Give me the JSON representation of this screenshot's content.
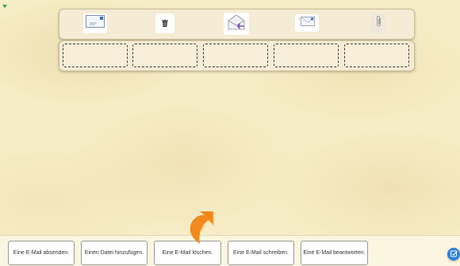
{
  "toolbar_icons": [
    {
      "name": "send-mail-icon"
    },
    {
      "name": "trash-icon"
    },
    {
      "name": "reply-mail-icon"
    },
    {
      "name": "write-mail-icon"
    },
    {
      "name": "paperclip-icon"
    }
  ],
  "drop_slots": 5,
  "answers": [
    {
      "label": "Eine E-Mail absenden."
    },
    {
      "label": "Einen Datei hinzufügen."
    },
    {
      "label": "Eine E-Mail löschen."
    },
    {
      "label": "Eine E-Mail schreiben."
    },
    {
      "label": "Eine E-Mail beantworten."
    }
  ],
  "colors": {
    "background": "#f6edc6",
    "pointer": "#f08a1c",
    "help_button": "#2f7fe0"
  }
}
